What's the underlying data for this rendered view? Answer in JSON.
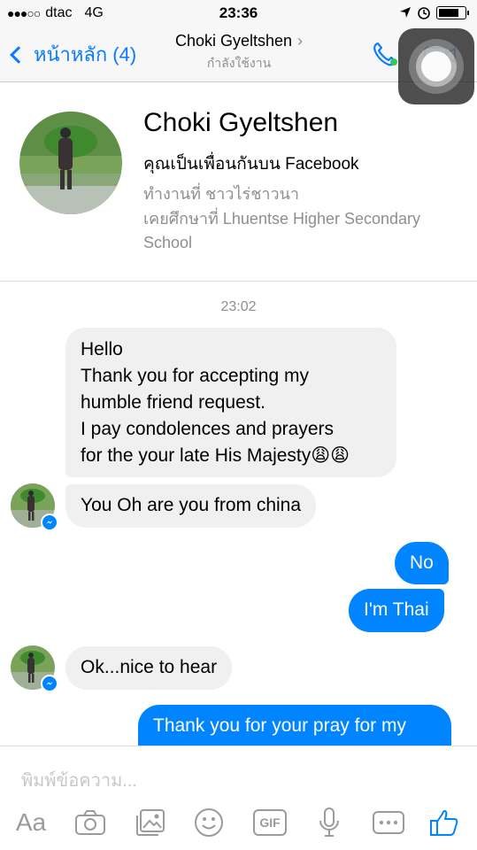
{
  "status_bar": {
    "signal": "●●●○○",
    "carrier": "dtac",
    "network": "4G",
    "time": "23:36"
  },
  "nav": {
    "back_label": "หน้าหลัก (4)",
    "title": "Choki Gyeltshen",
    "subtitle": "กำลังใช้งาน"
  },
  "profile": {
    "name": "Choki Gyeltshen",
    "friends_line": "คุณเป็นเพื่อนกันบน Facebook",
    "work": "ทำงานที่ ชาวไร่ชาวนา",
    "education": "เคยศึกษาที่ Lhuentse Higher Secondary School"
  },
  "chat": {
    "timestamp": "23:02",
    "messages": [
      {
        "direction": "incoming",
        "lines": [
          "Hello",
          "Thank you for accepting my",
          "humble friend request.",
          "I pay condolences and prayers",
          "for the your late His Majesty😩😩"
        ]
      },
      {
        "direction": "incoming",
        "text": "You Oh are you from china"
      },
      {
        "direction": "outgoing",
        "text": "No"
      },
      {
        "direction": "outgoing",
        "text": "I'm Thai"
      },
      {
        "direction": "incoming",
        "text": "Ok...nice to hear"
      },
      {
        "direction": "outgoing",
        "text": "Thank you for your pray for my"
      }
    ]
  },
  "composer": {
    "placeholder": "พิมพ์ข้อความ...",
    "aa_label": "Aa",
    "gif_label": "GIF"
  },
  "icons": {
    "back": "chevron-left-icon",
    "phone": "phone-icon",
    "video": "video-camera-icon",
    "camera": "camera-icon",
    "gallery": "photo-gallery-icon",
    "emoji": "smiley-icon",
    "mic": "microphone-icon",
    "more": "more-dots-icon",
    "like": "thumbs-up-icon",
    "messenger_badge": "messenger-badge-icon"
  },
  "colors": {
    "accent": "#0a7aff",
    "outgoing_bubble": "#0084ff",
    "incoming_bubble": "#f1f0f0",
    "online_dot": "#34c759"
  }
}
